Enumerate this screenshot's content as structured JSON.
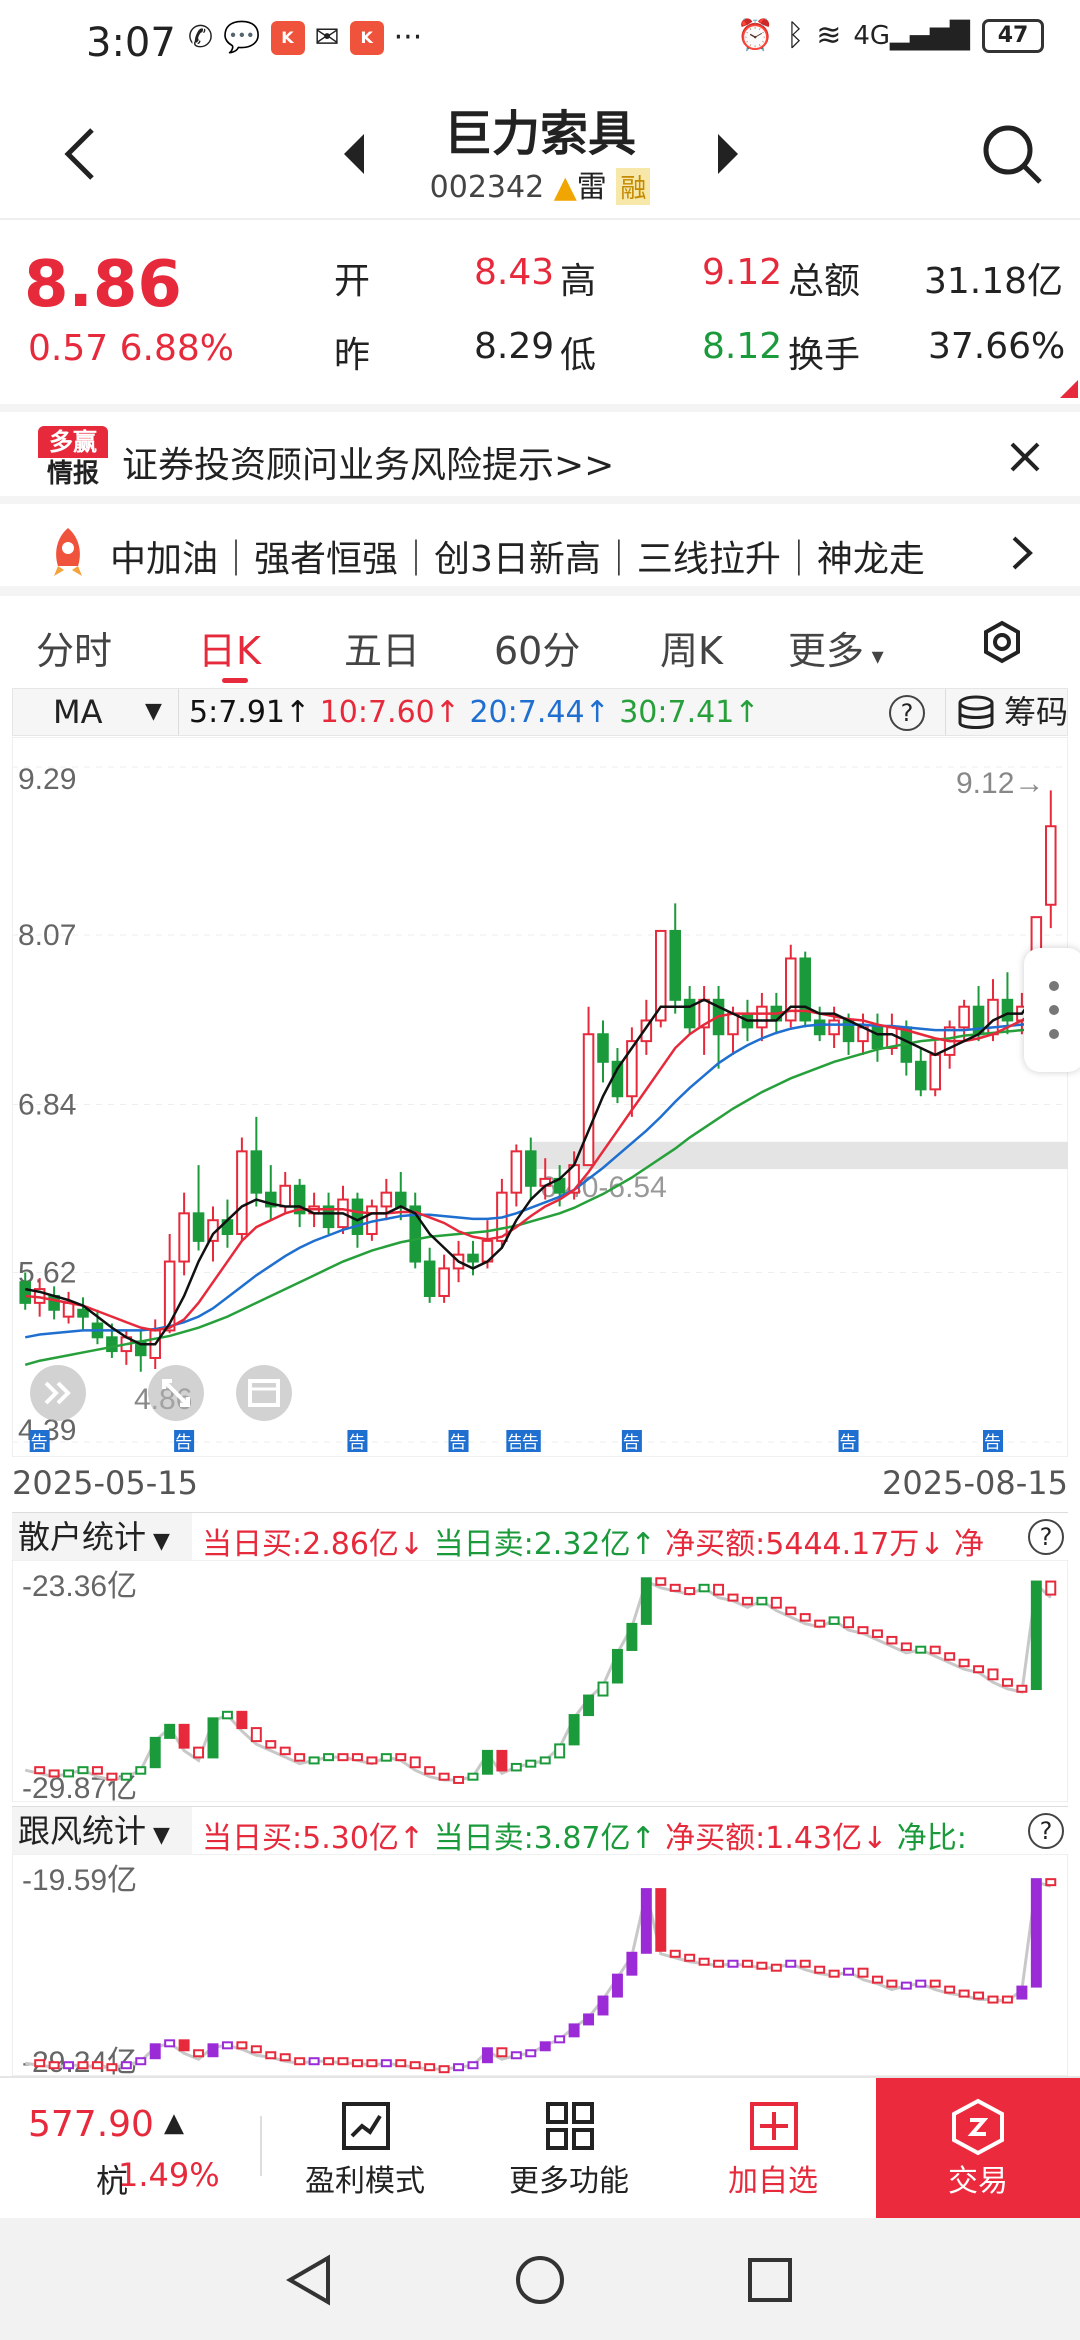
{
  "status_bar": {
    "time": "3:07",
    "battery": "47",
    "dots": "···"
  },
  "header": {
    "name": "巨力索具",
    "code": "002342",
    "tag_lei": "雷",
    "tag_rong": "融"
  },
  "quote": {
    "price": "8.86",
    "change": "0.57",
    "change_pct": "6.88%",
    "open_label": "开",
    "open": "8.43",
    "high_label": "高",
    "high": "9.12",
    "amount_label": "总额",
    "amount": "31.18亿",
    "prev_label": "昨",
    "prev": "8.29",
    "low_label": "低",
    "low": "8.12",
    "turnover_label": "换手",
    "turnover": "37.66%"
  },
  "risk_banner": {
    "logo_top": "多赢",
    "logo_bottom": "情报",
    "text": "证券投资顾问业务风险提示>>"
  },
  "ticker": {
    "text": "中加油｜强者恒强｜创3日新高｜三线拉升｜神龙走"
  },
  "tabs": [
    "分时",
    "日K",
    "五日",
    "60分",
    "周K",
    "更多"
  ],
  "active_tab": "日K",
  "ma_row": {
    "indicator": "MA",
    "ma5": "5:7.91↑",
    "ma10": "10:7.60↑",
    "ma20": "20:7.44↑",
    "ma30": "30:7.41↑",
    "help": "?",
    "chips_label": "筹码"
  },
  "chart_data": {
    "type": "candlestick",
    "title": "",
    "y_ticks": [
      "9.29",
      "8.07",
      "6.84",
      "5.62",
      "4.39"
    ],
    "ylim": [
      4.39,
      9.29
    ],
    "max_label": "9.12",
    "min_label": "4.86",
    "zone_label": "6.40-6.54",
    "zone": [
      6.4,
      6.54
    ],
    "x_start": "2025-05-15",
    "x_end": "2025-08-15",
    "announce_mark": "告",
    "candles": [
      [
        5.55,
        5.4,
        5.62,
        5.35
      ],
      [
        5.4,
        5.5,
        5.58,
        5.3
      ],
      [
        5.45,
        5.35,
        5.52,
        5.28
      ],
      [
        5.3,
        5.4,
        5.48,
        5.25
      ],
      [
        5.35,
        5.3,
        5.44,
        5.2
      ],
      [
        5.25,
        5.15,
        5.35,
        5.1
      ],
      [
        5.15,
        5.05,
        5.25,
        5.0
      ],
      [
        5.05,
        5.15,
        5.2,
        4.95
      ],
      [
        5.12,
        5.02,
        5.2,
        4.9
      ],
      [
        5.0,
        5.2,
        5.28,
        4.92
      ],
      [
        5.2,
        5.7,
        5.9,
        5.18
      ],
      [
        5.7,
        6.05,
        6.2,
        5.6
      ],
      [
        6.05,
        5.85,
        6.4,
        5.78
      ],
      [
        5.85,
        6.0,
        6.1,
        5.7
      ],
      [
        6.0,
        5.9,
        6.15,
        5.8
      ],
      [
        5.9,
        6.5,
        6.6,
        5.85
      ],
      [
        6.5,
        6.2,
        6.75,
        6.1
      ],
      [
        6.2,
        6.1,
        6.4,
        6.0
      ],
      [
        6.1,
        6.25,
        6.35,
        6.05
      ],
      [
        6.25,
        6.05,
        6.3,
        5.95
      ],
      [
        6.05,
        6.1,
        6.2,
        5.95
      ],
      [
        6.1,
        5.95,
        6.2,
        5.9
      ],
      [
        5.95,
        6.15,
        6.25,
        5.9
      ],
      [
        6.15,
        5.9,
        6.2,
        5.8
      ],
      [
        5.9,
        6.1,
        6.15,
        5.85
      ],
      [
        6.1,
        6.2,
        6.3,
        6.0
      ],
      [
        6.2,
        6.1,
        6.35,
        6.0
      ],
      [
        6.1,
        5.7,
        6.2,
        5.65
      ],
      [
        5.7,
        5.45,
        5.8,
        5.4
      ],
      [
        5.45,
        5.65,
        5.75,
        5.4
      ],
      [
        5.65,
        5.75,
        5.85,
        5.55
      ],
      [
        5.75,
        5.7,
        5.85,
        5.6
      ],
      [
        5.7,
        5.85,
        6.0,
        5.65
      ],
      [
        5.85,
        6.2,
        6.3,
        5.8
      ],
      [
        6.2,
        6.5,
        6.55,
        6.1
      ],
      [
        6.5,
        6.25,
        6.6,
        6.15
      ],
      [
        6.25,
        6.3,
        6.45,
        6.15
      ],
      [
        6.3,
        6.2,
        6.4,
        6.1
      ],
      [
        6.2,
        6.4,
        6.5,
        6.15
      ],
      [
        6.4,
        7.35,
        7.55,
        6.4
      ],
      [
        7.35,
        7.15,
        7.45,
        7.0
      ],
      [
        7.15,
        6.9,
        7.25,
        6.85
      ],
      [
        6.9,
        7.3,
        7.4,
        6.75
      ],
      [
        7.3,
        7.45,
        7.6,
        7.2
      ],
      [
        7.45,
        8.1,
        8.1,
        7.4
      ],
      [
        8.1,
        7.6,
        8.3,
        7.5
      ],
      [
        7.6,
        7.4,
        7.7,
        7.35
      ],
      [
        7.4,
        7.6,
        7.7,
        7.2
      ],
      [
        7.6,
        7.35,
        7.7,
        7.1
      ],
      [
        7.35,
        7.5,
        7.55,
        7.2
      ],
      [
        7.5,
        7.4,
        7.6,
        7.3
      ],
      [
        7.4,
        7.55,
        7.65,
        7.3
      ],
      [
        7.55,
        7.45,
        7.65,
        7.35
      ],
      [
        7.45,
        7.9,
        8.0,
        7.4
      ],
      [
        7.9,
        7.45,
        7.95,
        7.4
      ],
      [
        7.45,
        7.35,
        7.55,
        7.3
      ],
      [
        7.35,
        7.45,
        7.55,
        7.25
      ],
      [
        7.45,
        7.3,
        7.5,
        7.2
      ],
      [
        7.3,
        7.4,
        7.5,
        7.2
      ],
      [
        7.4,
        7.25,
        7.5,
        7.15
      ],
      [
        7.25,
        7.4,
        7.5,
        7.2
      ],
      [
        7.4,
        7.15,
        7.45,
        7.05
      ],
      [
        7.15,
        6.95,
        7.25,
        6.9
      ],
      [
        6.95,
        7.2,
        7.3,
        6.9
      ],
      [
        7.2,
        7.4,
        7.45,
        7.1
      ],
      [
        7.4,
        7.55,
        7.6,
        7.3
      ],
      [
        7.55,
        7.35,
        7.7,
        7.3
      ],
      [
        7.35,
        7.6,
        7.75,
        7.3
      ],
      [
        7.6,
        7.45,
        7.8,
        7.35
      ],
      [
        7.45,
        7.55,
        7.65,
        7.35
      ],
      [
        7.55,
        8.2,
        8.2,
        7.5
      ],
      [
        8.29,
        8.86,
        9.12,
        8.12
      ]
    ],
    "ma5": [
      5.5,
      5.48,
      5.45,
      5.42,
      5.38,
      5.3,
      5.22,
      5.15,
      5.1,
      5.1,
      5.25,
      5.45,
      5.7,
      5.9,
      6.0,
      6.1,
      6.15,
      6.12,
      6.1,
      6.1,
      6.05,
      6.05,
      6.05,
      6.0,
      6.05,
      6.05,
      6.1,
      6.05,
      5.9,
      5.8,
      5.7,
      5.65,
      5.7,
      5.8,
      6.0,
      6.15,
      6.25,
      6.3,
      6.4,
      6.65,
      6.9,
      7.1,
      7.25,
      7.4,
      7.55,
      7.55,
      7.55,
      7.6,
      7.55,
      7.5,
      7.45,
      7.45,
      7.45,
      7.55,
      7.55,
      7.5,
      7.5,
      7.45,
      7.4,
      7.35,
      7.35,
      7.3,
      7.25,
      7.2,
      7.25,
      7.3,
      7.35,
      7.45,
      7.5,
      7.5,
      7.65,
      7.91
    ],
    "ma10": [
      5.45,
      5.44,
      5.42,
      5.4,
      5.38,
      5.34,
      5.3,
      5.26,
      5.22,
      5.2,
      5.22,
      5.28,
      5.4,
      5.55,
      5.7,
      5.85,
      5.95,
      6.0,
      6.05,
      6.08,
      6.08,
      6.08,
      6.08,
      6.06,
      6.05,
      6.05,
      6.06,
      6.06,
      6.02,
      5.98,
      5.92,
      5.88,
      5.86,
      5.88,
      5.95,
      6.03,
      6.1,
      6.15,
      6.22,
      6.35,
      6.5,
      6.65,
      6.8,
      6.95,
      7.1,
      7.25,
      7.35,
      7.42,
      7.48,
      7.5,
      7.5,
      7.5,
      7.5,
      7.52,
      7.52,
      7.5,
      7.48,
      7.46,
      7.45,
      7.42,
      7.4,
      7.38,
      7.35,
      7.32,
      7.3,
      7.3,
      7.32,
      7.35,
      7.4,
      7.45,
      7.52,
      7.6
    ],
    "ma20": [
      5.15,
      5.17,
      5.18,
      5.19,
      5.2,
      5.2,
      5.2,
      5.2,
      5.2,
      5.21,
      5.23,
      5.26,
      5.3,
      5.36,
      5.44,
      5.52,
      5.6,
      5.67,
      5.74,
      5.8,
      5.85,
      5.89,
      5.93,
      5.96,
      5.99,
      6.01,
      6.03,
      6.04,
      6.04,
      6.03,
      6.02,
      6.01,
      6.01,
      6.02,
      6.05,
      6.09,
      6.13,
      6.17,
      6.22,
      6.3,
      6.38,
      6.47,
      6.56,
      6.65,
      6.75,
      6.86,
      6.96,
      7.05,
      7.14,
      7.21,
      7.27,
      7.32,
      7.36,
      7.39,
      7.41,
      7.42,
      7.42,
      7.42,
      7.42,
      7.41,
      7.41,
      7.4,
      7.39,
      7.38,
      7.38,
      7.38,
      7.39,
      7.4,
      7.41,
      7.42,
      7.43,
      7.44
    ],
    "ma30": [
      4.95,
      4.98,
      5.0,
      5.02,
      5.04,
      5.06,
      5.08,
      5.1,
      5.12,
      5.14,
      5.16,
      5.19,
      5.22,
      5.26,
      5.3,
      5.35,
      5.4,
      5.45,
      5.5,
      5.55,
      5.6,
      5.65,
      5.7,
      5.74,
      5.78,
      5.81,
      5.84,
      5.86,
      5.88,
      5.89,
      5.9,
      5.91,
      5.92,
      5.94,
      5.96,
      5.99,
      6.02,
      6.05,
      6.09,
      6.14,
      6.19,
      6.25,
      6.31,
      6.38,
      6.45,
      6.52,
      6.6,
      6.67,
      6.74,
      6.81,
      6.87,
      6.93,
      6.98,
      7.03,
      7.07,
      7.11,
      7.15,
      7.18,
      7.21,
      7.24,
      7.26,
      7.28,
      7.3,
      7.31,
      7.32,
      7.34,
      7.35,
      7.36,
      7.37,
      7.38,
      7.39,
      7.41
    ],
    "announce_days": [
      1,
      11,
      23,
      30,
      34,
      35,
      42,
      57,
      67
    ]
  },
  "retail_panel": {
    "selector": "散户统计",
    "vals": [
      {
        "t": "当日买:2.86亿↓",
        "c": "red"
      },
      {
        "t": " 当日卖:2.32亿↑",
        "c": "green"
      },
      {
        "t": " 净买额:5444.17万↓",
        "c": "red"
      },
      {
        "t": " 净",
        "c": "red"
      }
    ],
    "top_label": "-23.36亿",
    "bottom_label": "-29.87亿",
    "help": "?",
    "line": [
      29.2,
      29.3,
      29.4,
      29.3,
      29.2,
      29.4,
      29.5,
      29.4,
      29.2,
      28.3,
      27.9,
      28.6,
      28.9,
      27.7,
      27.5,
      28.0,
      28.4,
      28.6,
      28.8,
      29.0,
      28.9,
      28.8,
      28.8,
      28.9,
      29.0,
      28.8,
      28.9,
      29.2,
      29.4,
      29.5,
      29.5,
      29.4,
      28.7,
      29.3,
      29.1,
      29.0,
      28.9,
      28.5,
      27.6,
      27.0,
      26.6,
      25.6,
      24.8,
      23.4,
      23.6,
      23.7,
      23.8,
      23.6,
      23.9,
      24.0,
      24.2,
      24.0,
      24.3,
      24.5,
      24.7,
      24.8,
      24.6,
      24.9,
      25.0,
      25.2,
      25.4,
      25.6,
      25.5,
      25.7,
      25.9,
      26.1,
      26.2,
      26.5,
      26.7,
      26.8,
      23.5,
      23.9
    ]
  },
  "trend_panel": {
    "selector": "跟风统计",
    "vals": [
      {
        "t": "当日买:5.30亿↑",
        "c": "red"
      },
      {
        "t": " 当日卖:3.87亿↑",
        "c": "green"
      },
      {
        "t": " 净买额:1.43亿↓",
        "c": "red"
      },
      {
        "t": " 净比:",
        "c": "green"
      }
    ],
    "top_label": "-19.59亿",
    "bottom_label": "-29.24亿",
    "help": "?",
    "line": [
      29.1,
      29.2,
      29.3,
      29.2,
      29.2,
      29.3,
      29.3,
      29.2,
      29.0,
      28.3,
      28.1,
      28.6,
      28.9,
      28.3,
      28.2,
      28.4,
      28.7,
      28.8,
      29.0,
      29.1,
      29.0,
      29.0,
      29.1,
      29.1,
      29.2,
      29.1,
      29.2,
      29.3,
      29.4,
      29.4,
      29.3,
      29.2,
      28.5,
      28.9,
      28.7,
      28.6,
      28.2,
      27.9,
      27.3,
      26.8,
      25.9,
      24.8,
      23.7,
      20.5,
      23.6,
      23.8,
      24.0,
      24.1,
      24.2,
      24.1,
      24.2,
      24.3,
      24.3,
      24.1,
      24.4,
      24.6,
      24.7,
      24.5,
      24.9,
      25.1,
      25.4,
      25.2,
      25.1,
      25.4,
      25.6,
      25.7,
      25.9,
      25.9,
      26.0,
      25.4,
      20.0,
      20.2
    ]
  },
  "bottom_bar": {
    "index_value": "577.90",
    "index_arrow": "▲",
    "index_name": "杭",
    "index_pct": "1.49%",
    "btn_profit": "盈利模式",
    "btn_more": "更多功能",
    "btn_watch": "加自选",
    "btn_trade": "交易"
  },
  "colors": {
    "up": "#e62a3c",
    "down": "#1a9a3a",
    "ma5": "#111111",
    "ma10": "#e62a3c",
    "ma20": "#1f6fd0",
    "ma30": "#27a03c",
    "trend_up": "#9b2bd6",
    "trade_btn": "#ec2a3d"
  }
}
